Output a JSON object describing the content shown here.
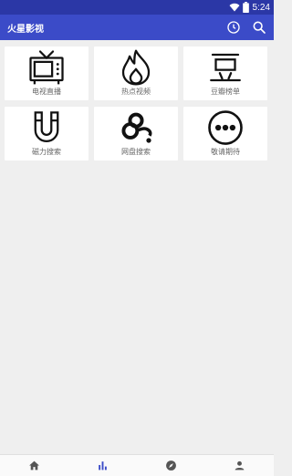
{
  "status": {
    "time": "5:24"
  },
  "header": {
    "title": "火星影视"
  },
  "colors": {
    "status_bar": "#2b37a6",
    "app_bar": "#3b4bc8",
    "background": "#efefef",
    "nav_active": "#3b4bc8",
    "nav_inactive": "#555555"
  },
  "tiles": [
    {
      "label": "电视直播",
      "icon": "tv-icon"
    },
    {
      "label": "热点视频",
      "icon": "flame-icon"
    },
    {
      "label": "豆瓣榜单",
      "icon": "douban-icon"
    },
    {
      "label": "磁力搜索",
      "icon": "magnet-icon"
    },
    {
      "label": "网盘搜索",
      "icon": "cloud-drive-icon"
    },
    {
      "label": "敬请期待",
      "icon": "more-icon"
    }
  ],
  "bottom_nav": [
    {
      "icon": "home-icon",
      "active": false
    },
    {
      "icon": "bar-chart-icon",
      "active": true
    },
    {
      "icon": "compass-icon",
      "active": false
    },
    {
      "icon": "person-icon",
      "active": false
    }
  ]
}
